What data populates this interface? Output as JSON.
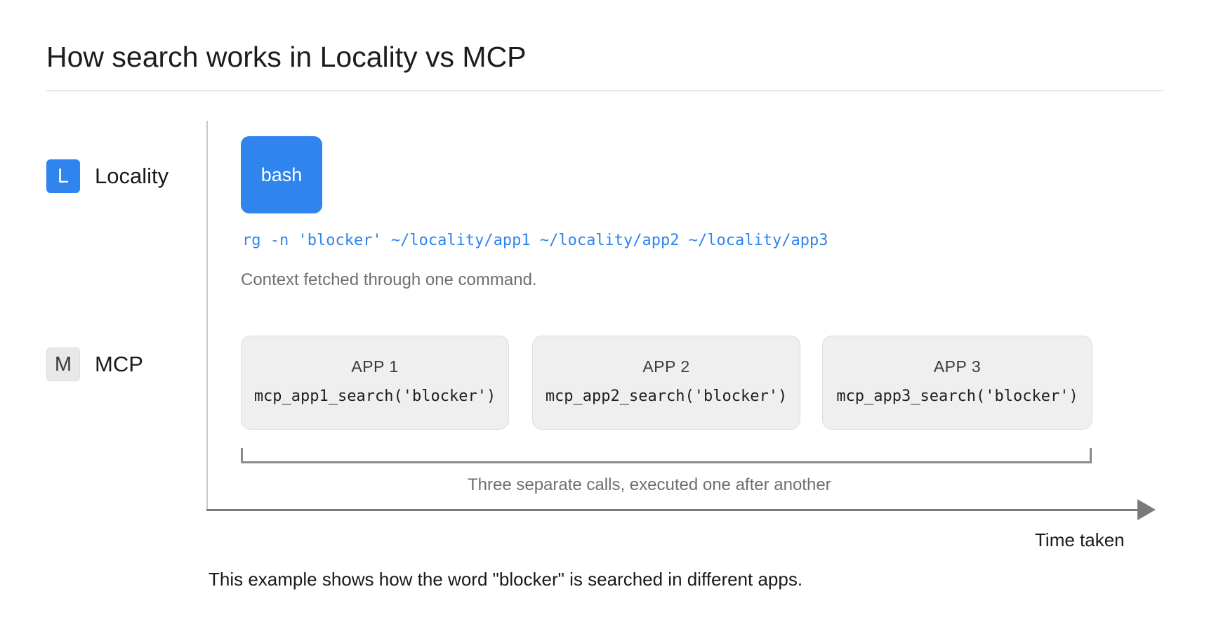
{
  "title": "How search works in Locality vs MCP",
  "rows": {
    "locality": {
      "badge": "L",
      "label": "Locality"
    },
    "mcp": {
      "badge": "M",
      "label": "MCP"
    }
  },
  "locality_flow": {
    "tool_label": "bash",
    "command": "rg -n 'blocker' ~/locality/app1 ~/locality/app2 ~/locality/app3",
    "caption": "Context fetched through one command."
  },
  "mcp_flow": {
    "apps": [
      {
        "name": "APP 1",
        "call": "mcp_app1_search('blocker')"
      },
      {
        "name": "APP 2",
        "call": "mcp_app2_search('blocker')"
      },
      {
        "name": "APP 3",
        "call": "mcp_app3_search('blocker')"
      }
    ],
    "caption": "Three separate calls, executed one after another"
  },
  "time_axis_label": "Time taken",
  "footnote": "This example shows how the word \"blocker\" is searched in different apps.",
  "colors": {
    "accent": "#2f84ee",
    "app_box": "#efefef",
    "axis": "#7a7a7a",
    "muted_text": "#6f6f6f"
  }
}
